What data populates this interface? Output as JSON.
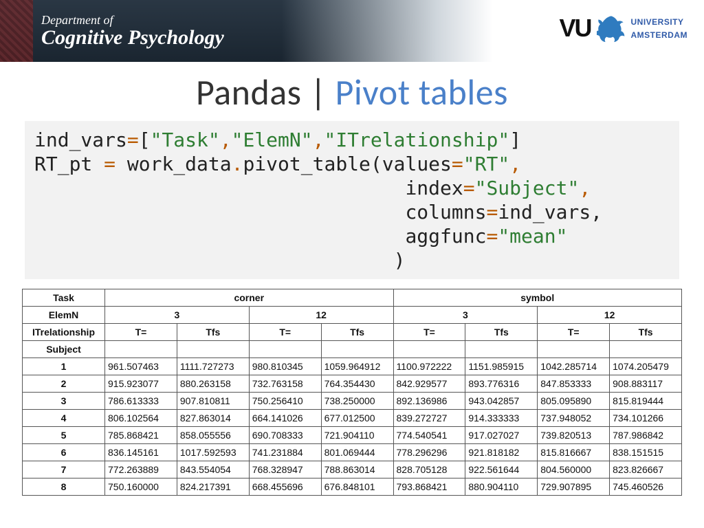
{
  "header": {
    "dept_line1": "Department of",
    "dept_line2": "Cognitive Psychology",
    "vu": "VU",
    "uni_line1": "UNIVERSITY",
    "uni_line2": "AMSTERDAM"
  },
  "title": {
    "part1": "Pandas | ",
    "part2": "Pivot tables"
  },
  "code": {
    "t01": "ind_vars",
    "t02": "=",
    "t03": "[",
    "t04": "\"Task\"",
    "t05": ",",
    "t06": "\"ElemN\"",
    "t07": ",",
    "t08": "\"ITrelationship\"",
    "t09": "]",
    "t10": "RT_pt ",
    "t11": "=",
    "t12": " work_data",
    "t13": ".",
    "t14": "pivot_table(values",
    "t15": "=",
    "t16": "\"RT\"",
    "t17": ",",
    "pad": "                                ",
    "t18": "index",
    "t19": "=",
    "t20": "\"Subject\"",
    "t21": ",",
    "t22": "columns",
    "t23": "=",
    "t24": "ind_vars,",
    "t25": "aggfunc",
    "t26": "=",
    "t27": "\"mean\"",
    "pad2": "                               ",
    "t28": ")"
  },
  "table": {
    "idx_labels": {
      "task": "Task",
      "elemn": "ElemN",
      "itrel": "ITrelationship",
      "subject": "Subject"
    },
    "task_cols": [
      "corner",
      "symbol"
    ],
    "elemn_cols": [
      "3",
      "12",
      "3",
      "12"
    ],
    "itrel_cols": [
      "T=",
      "Tfs",
      "T=",
      "Tfs",
      "T=",
      "Tfs",
      "T=",
      "Tfs"
    ],
    "rows": [
      {
        "s": "1",
        "v": [
          "961.507463",
          "1111.727273",
          "980.810345",
          "1059.964912",
          "1100.972222",
          "1151.985915",
          "1042.285714",
          "1074.205479"
        ]
      },
      {
        "s": "2",
        "v": [
          "915.923077",
          "880.263158",
          "732.763158",
          "764.354430",
          "842.929577",
          "893.776316",
          "847.853333",
          "908.883117"
        ]
      },
      {
        "s": "3",
        "v": [
          "786.613333",
          "907.810811",
          "750.256410",
          "738.250000",
          "892.136986",
          "943.042857",
          "805.095890",
          "815.819444"
        ]
      },
      {
        "s": "4",
        "v": [
          "806.102564",
          "827.863014",
          "664.141026",
          "677.012500",
          "839.272727",
          "914.333333",
          "737.948052",
          "734.101266"
        ]
      },
      {
        "s": "5",
        "v": [
          "785.868421",
          "858.055556",
          "690.708333",
          "721.904110",
          "774.540541",
          "917.027027",
          "739.820513",
          "787.986842"
        ]
      },
      {
        "s": "6",
        "v": [
          "836.145161",
          "1017.592593",
          "741.231884",
          "801.069444",
          "778.296296",
          "921.818182",
          "815.816667",
          "838.151515"
        ]
      },
      {
        "s": "7",
        "v": [
          "772.263889",
          "843.554054",
          "768.328947",
          "788.863014",
          "828.705128",
          "922.561644",
          "804.560000",
          "823.826667"
        ]
      },
      {
        "s": "8",
        "v": [
          "750.160000",
          "824.217391",
          "668.455696",
          "676.848101",
          "793.868421",
          "880.904110",
          "729.907895",
          "745.460526"
        ]
      }
    ]
  }
}
